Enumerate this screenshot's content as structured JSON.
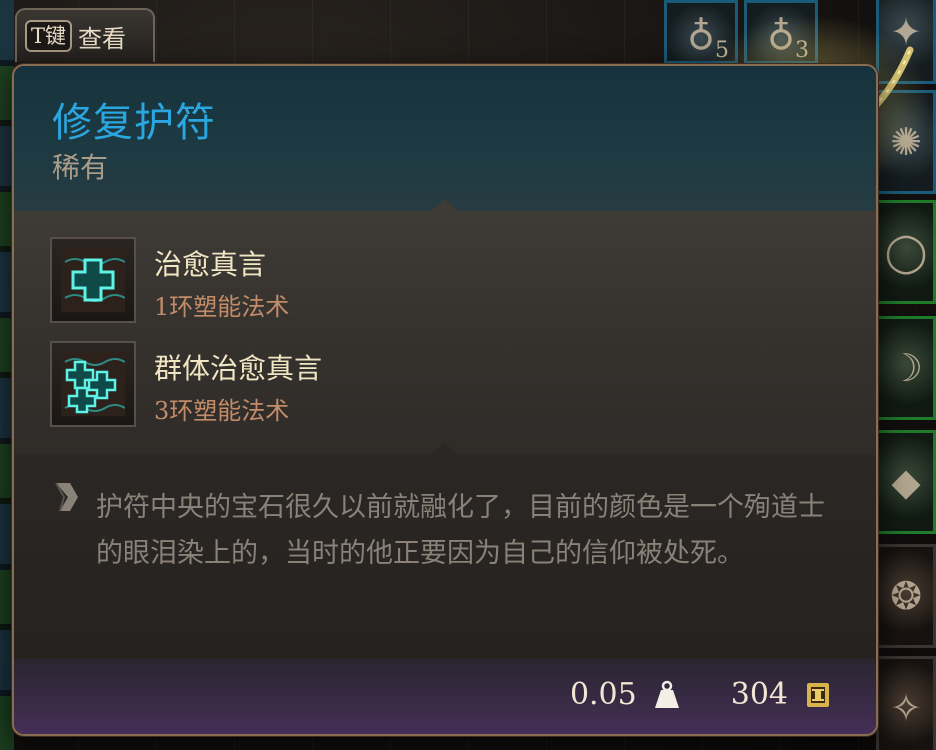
{
  "hint": {
    "key": "T键",
    "label": "查看"
  },
  "item": {
    "name": "修复护符",
    "rarity": "稀有",
    "name_color": "#2aa7e0",
    "spells": [
      {
        "name": "治愈真言",
        "level": "1环塑能法术",
        "icon": "healing-word-icon"
      },
      {
        "name": "群体治愈真言",
        "level": "3环塑能法术",
        "icon": "mass-healing-word-icon"
      }
    ],
    "description": "护符中央的宝石很久以前就融化了，目前的颜色是一个殉道士的眼泪染上的，当时的他正要因为自己的信仰被处死。",
    "weight": "0.05",
    "value": "304"
  },
  "inventory": {
    "top_counts": [
      "5",
      "3"
    ]
  }
}
